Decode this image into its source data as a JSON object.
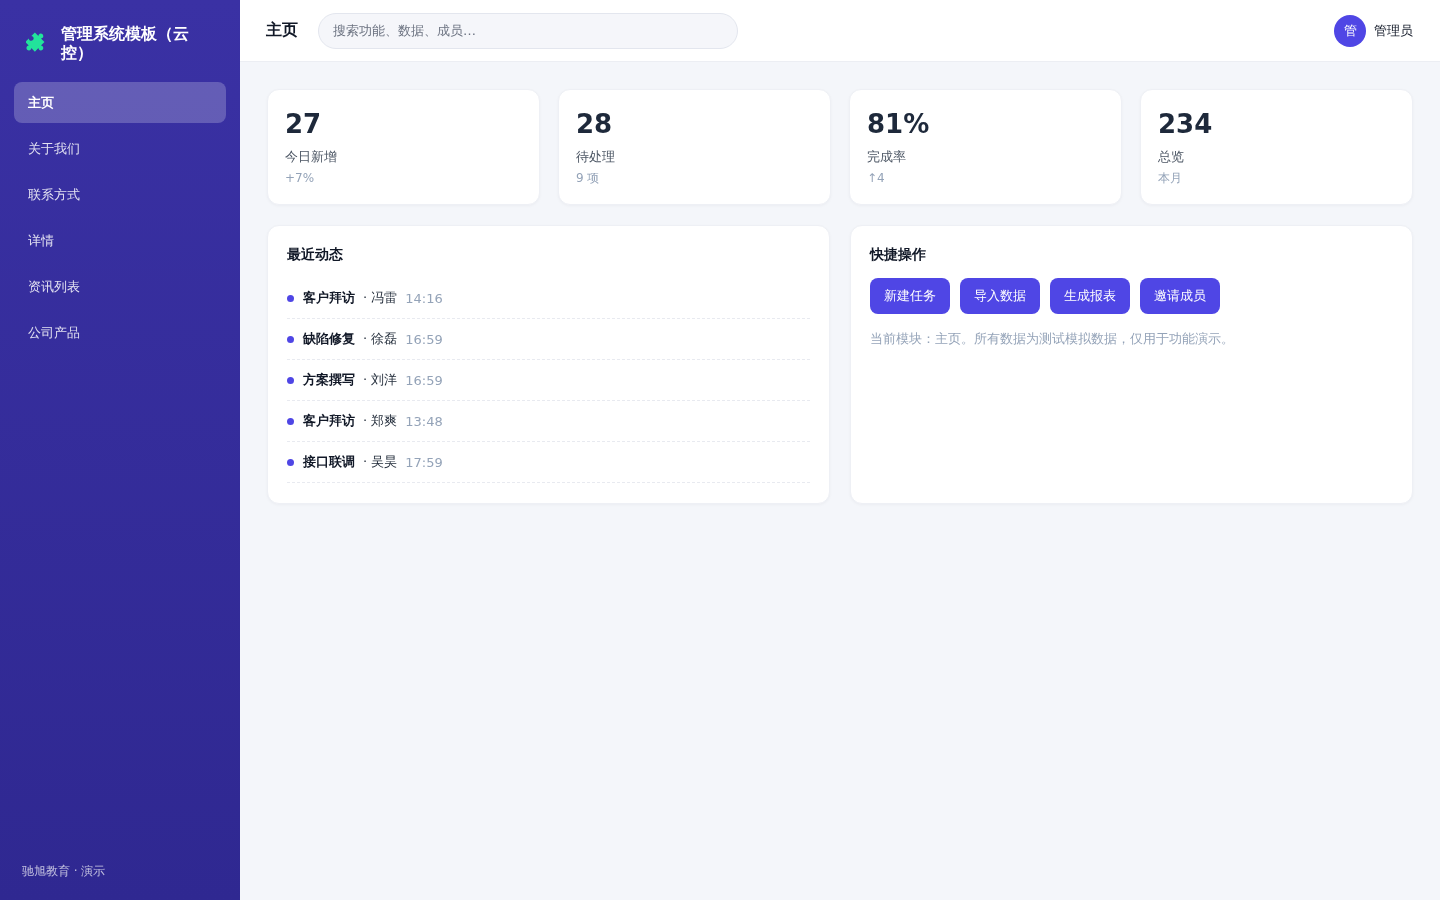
{
  "sidebar": {
    "brand": {
      "title": "管理系统模板（云控）"
    },
    "items": [
      {
        "label": "主页",
        "selected": true
      },
      {
        "label": "关于我们",
        "selected": false
      },
      {
        "label": "联系方式",
        "selected": false
      },
      {
        "label": "详情",
        "selected": false
      },
      {
        "label": "资讯列表",
        "selected": false
      },
      {
        "label": "公司产品",
        "selected": false
      }
    ],
    "footer": "驰旭教育 · 演示"
  },
  "header": {
    "title": "主页",
    "search": {
      "placeholder": "搜索功能、数据、成员…"
    },
    "user": {
      "avatar": "管",
      "name": "管理员"
    }
  },
  "stats": [
    {
      "value": "27",
      "label": "今日新增",
      "note": "+7%"
    },
    {
      "value": "28",
      "label": "待处理",
      "note": "9 项"
    },
    {
      "value": "81%",
      "label": "完成率",
      "note": "↑4"
    },
    {
      "value": "234",
      "label": "总览",
      "note": "本月"
    }
  ],
  "recent": {
    "title": "最近动态",
    "items": [
      {
        "title": "客户拜访",
        "person": "· 冯雷",
        "time": "14:16"
      },
      {
        "title": "缺陷修复",
        "person": "· 徐磊",
        "time": "16:59"
      },
      {
        "title": "方案撰写",
        "person": "· 刘洋",
        "time": "16:59"
      },
      {
        "title": "客户拜访",
        "person": "· 郑爽",
        "time": "13:48"
      },
      {
        "title": "接口联调",
        "person": "· 吴昊",
        "time": "17:59"
      }
    ]
  },
  "quick_actions": {
    "title": "快捷操作",
    "buttons": [
      "新建任务",
      "导入数据",
      "生成报表",
      "邀请成员"
    ],
    "note": "当前模块：主页。所有数据为测试模拟数据，仅用于功能演示。"
  }
}
